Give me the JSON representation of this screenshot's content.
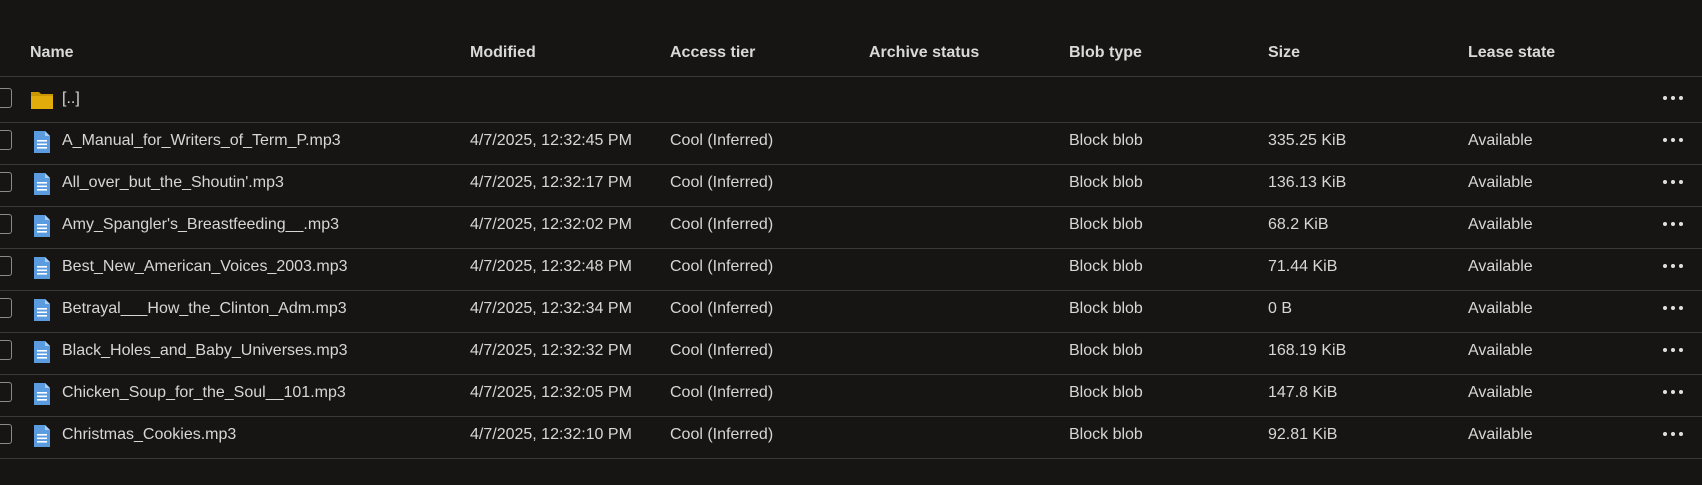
{
  "columns": {
    "name": "Name",
    "modified": "Modified",
    "access_tier": "Access tier",
    "archive_status": "Archive status",
    "blob_type": "Blob type",
    "size": "Size",
    "lease_state": "Lease state"
  },
  "parent_row": {
    "name": "[..]",
    "icon": "folder-icon"
  },
  "rows": [
    {
      "name": "A_Manual_for_Writers_of_Term_P.mp3",
      "modified": "4/7/2025, 12:32:45 PM",
      "access_tier": "Cool (Inferred)",
      "archive_status": "",
      "blob_type": "Block blob",
      "size": "335.25 KiB",
      "lease_state": "Available"
    },
    {
      "name": "All_over_but_the_Shoutin'.mp3",
      "modified": "4/7/2025, 12:32:17 PM",
      "access_tier": "Cool (Inferred)",
      "archive_status": "",
      "blob_type": "Block blob",
      "size": "136.13 KiB",
      "lease_state": "Available"
    },
    {
      "name": "Amy_Spangler's_Breastfeeding__.mp3",
      "modified": "4/7/2025, 12:32:02 PM",
      "access_tier": "Cool (Inferred)",
      "archive_status": "",
      "blob_type": "Block blob",
      "size": "68.2 KiB",
      "lease_state": "Available"
    },
    {
      "name": "Best_New_American_Voices_2003.mp3",
      "modified": "4/7/2025, 12:32:48 PM",
      "access_tier": "Cool (Inferred)",
      "archive_status": "",
      "blob_type": "Block blob",
      "size": "71.44 KiB",
      "lease_state": "Available"
    },
    {
      "name": "Betrayal___How_the_Clinton_Adm.mp3",
      "modified": "4/7/2025, 12:32:34 PM",
      "access_tier": "Cool (Inferred)",
      "archive_status": "",
      "blob_type": "Block blob",
      "size": "0 B",
      "lease_state": "Available"
    },
    {
      "name": "Black_Holes_and_Baby_Universes.mp3",
      "modified": "4/7/2025, 12:32:32 PM",
      "access_tier": "Cool (Inferred)",
      "archive_status": "",
      "blob_type": "Block blob",
      "size": "168.19 KiB",
      "lease_state": "Available"
    },
    {
      "name": "Chicken_Soup_for_the_Soul__101.mp3",
      "modified": "4/7/2025, 12:32:05 PM",
      "access_tier": "Cool (Inferred)",
      "archive_status": "",
      "blob_type": "Block blob",
      "size": "147.8 KiB",
      "lease_state": "Available"
    },
    {
      "name": "Christmas_Cookies.mp3",
      "modified": "4/7/2025, 12:32:10 PM",
      "access_tier": "Cool (Inferred)",
      "archive_status": "",
      "blob_type": "Block blob",
      "size": "92.81 KiB",
      "lease_state": "Available"
    }
  ],
  "row_icon": "file-icon",
  "colors": {
    "background": "#161514",
    "divider": "#3a3937",
    "folder": "#d9a300",
    "file_icon": "#4f8fd8"
  }
}
